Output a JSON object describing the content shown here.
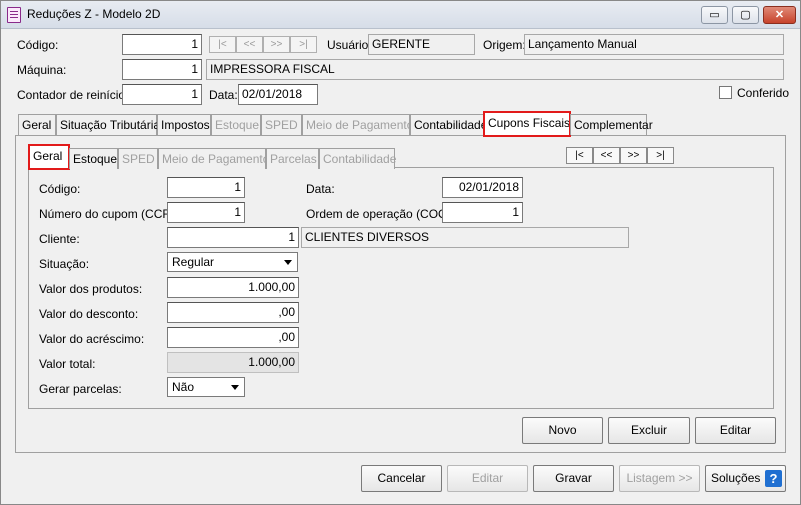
{
  "window": {
    "title": "Reduções Z - Modelo 2D",
    "min": "▭",
    "max": "▢",
    "close": "✕"
  },
  "header": {
    "codigo_label": "Código:",
    "codigo_value": "1",
    "nav": [
      "|<",
      "<<",
      ">>",
      ">|"
    ],
    "usuario_label": "Usuário:",
    "usuario_value": "GERENTE",
    "origem_label": "Origem:",
    "origem_value": "Lançamento Manual",
    "maquina_label": "Máquina:",
    "maquina_value": "1",
    "maquina_desc": "IMPRESSORA FISCAL",
    "contador_label": "Contador de reinício:",
    "contador_value": "1",
    "data_label": "Data:",
    "data_value": "02/01/2018",
    "conferido_label": "Conferido"
  },
  "main_tabs": [
    "Geral",
    "Situação Tributária",
    "Impostos",
    "Estoque",
    "SPED",
    "Meio de Pagamento",
    "Contabilidade",
    "Cupons Fiscais",
    "Complementar"
  ],
  "sub_tabs": [
    "Geral",
    "Estoque",
    "SPED",
    "Meio de Pagamento",
    "Parcelas",
    "Contabilidade"
  ],
  "sub_nav": [
    "|<",
    "<<",
    ">>",
    ">|"
  ],
  "form": {
    "codigo_label": "Código:",
    "codigo_value": "1",
    "data_label": "Data:",
    "data_value": "02/01/2018",
    "ccf_label": "Número do cupom (CCF):",
    "ccf_value": "1",
    "coo_label": "Ordem de operação (COO):",
    "coo_value": "1",
    "cliente_label": "Cliente:",
    "cliente_value": "1",
    "cliente_desc": "CLIENTES DIVERSOS",
    "situacao_label": "Situação:",
    "situacao_value": "Regular",
    "produtos_label": "Valor dos produtos:",
    "produtos_value": "1.000,00",
    "desconto_label": "Valor do desconto:",
    "desconto_value": ",00",
    "acrescimo_label": "Valor do acréscimo:",
    "acrescimo_value": ",00",
    "total_label": "Valor total:",
    "total_value": "1.000,00",
    "parcelas_label": "Gerar parcelas:",
    "parcelas_value": "Não"
  },
  "panel_buttons": {
    "novo": "Novo",
    "excluir": "Excluir",
    "editar": "Editar"
  },
  "footer_buttons": {
    "cancelar": "Cancelar",
    "editar": "Editar",
    "gravar": "Gravar",
    "listagem": "Listagem >>",
    "solucoes": "Soluções",
    "help": "?"
  },
  "colors": {
    "highlight": "#e21a1a",
    "help_icon": "#1f6fd1"
  }
}
